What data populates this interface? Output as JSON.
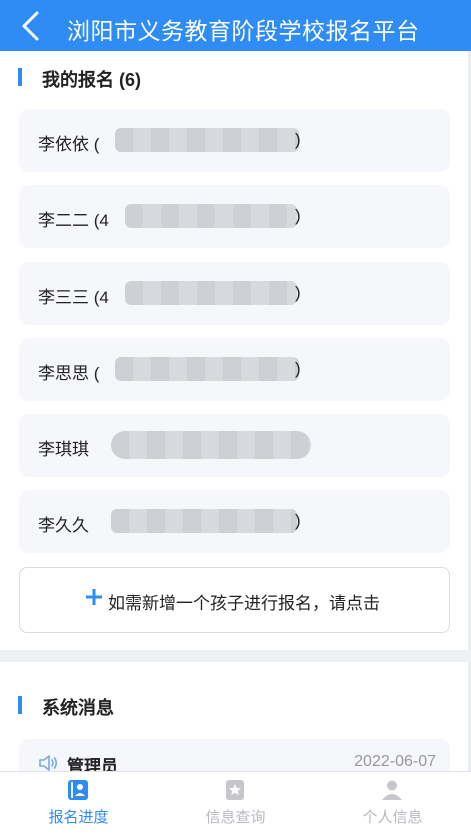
{
  "header": {
    "title": "浏阳市义务教育阶段学校报名平台"
  },
  "registrations": {
    "heading": "我的报名 (6)",
    "items": [
      {
        "name": "李依依 ("
      },
      {
        "name": "李二二 (4"
      },
      {
        "name": "李三三 (4"
      },
      {
        "name": "李思思 ("
      },
      {
        "name": "李琪琪"
      },
      {
        "name": "李久久"
      }
    ],
    "close_paren": ")",
    "add_label": "如需新增一个孩子进行报名，请点击"
  },
  "messages": {
    "heading": "系统消息",
    "items": [
      {
        "sender": "管理员",
        "date": "2022-06-07"
      }
    ]
  },
  "tabs": [
    {
      "label": "报名进度",
      "icon": "progress-icon",
      "active": true
    },
    {
      "label": "信息查询",
      "icon": "star-doc-icon",
      "active": false
    },
    {
      "label": "个人信息",
      "icon": "person-icon",
      "active": false
    }
  ],
  "colors": {
    "accent": "#2f8cf5",
    "card_bg": "#f6f7fb",
    "muted": "#b7b9bf"
  }
}
